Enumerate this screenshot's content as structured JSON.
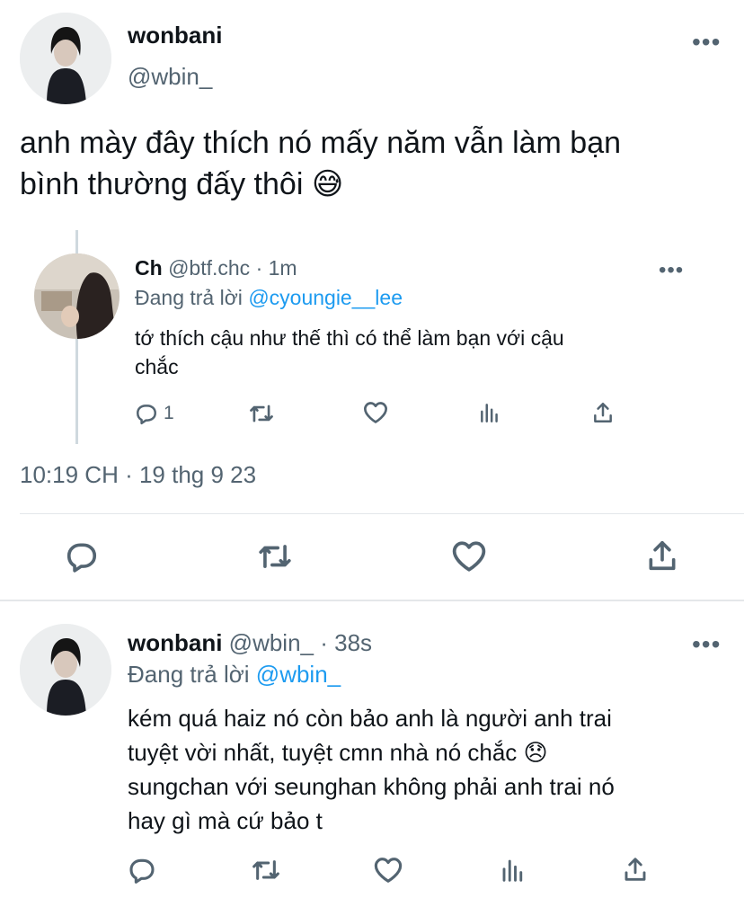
{
  "main_tweet": {
    "display_name": "wonbani",
    "handle": "@wbin_",
    "text_line1": "anh mày đây thích nó mấy năm vẫn làm bạn",
    "text_line2": "bình thường đấy thôi",
    "emoji": "😅",
    "timestamp": "10:19 CH · 19 thg 9 23"
  },
  "quoted_tweet": {
    "display_name": "Ch",
    "handle": "@btf.chc",
    "time": "· 1m",
    "replying_prefix": "Đang trả lời",
    "replying_to": "@cyoungie__lee",
    "text_line1": "tớ thích cậu như thế thì có thể làm bạn với cậu",
    "text_line2": "chắc",
    "reply_count": "1"
  },
  "reply_tweet": {
    "display_name": "wonbani",
    "handle": "@wbin_",
    "time": "· 38s",
    "replying_prefix": "Đang trả lời",
    "replying_to": "@wbin_",
    "text_line1": "kém quá haiz nó còn bảo anh là người anh trai",
    "text_line2": "tuyệt vời nhất, tuyệt cmn nhà nó chắc",
    "emoji": "😞",
    "text_line3": "sungchan với seunghan không phải anh trai nó",
    "text_line4": "hay gì mà cứ bảo t"
  },
  "colors": {
    "accent": "#1d9bf0",
    "secondary": "#536471",
    "divider": "#e4e7ea"
  },
  "icons": [
    "reply-icon",
    "retweet-icon",
    "like-icon",
    "views-icon",
    "share-icon",
    "more-icon"
  ]
}
